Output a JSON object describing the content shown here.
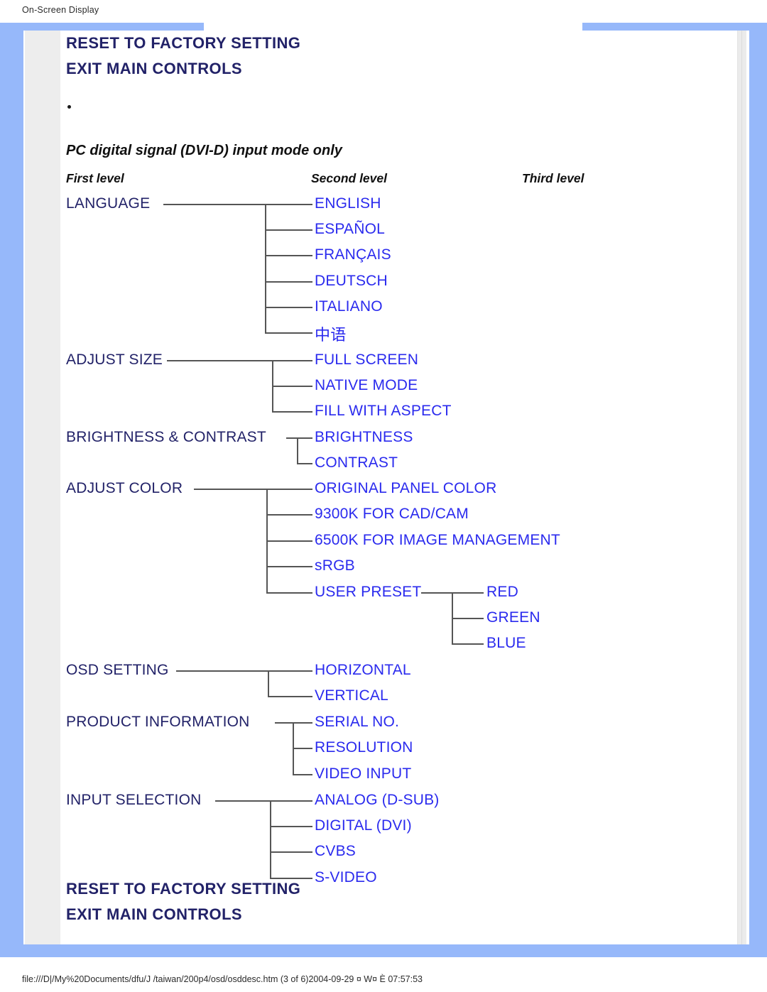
{
  "browser": {
    "title": "On-Screen Display",
    "status_url": "file:///D|/My%20Documents/dfu/J /taiwan/200p4/osd/osddesc.htm (3 of 6)2004-09-29 ¤ W¤ È 07:57:53"
  },
  "colors": {
    "page_border_blue": "#96b8fa",
    "gutter_gray": "#ededed",
    "heading_navy": "#222268",
    "menu_blue": "#2a2aee",
    "connector_gray": "#555555"
  },
  "headings": {
    "top": [
      "RESET TO FACTORY SETTING",
      "EXIT MAIN CONTROLS"
    ],
    "bottom": [
      "RESET TO FACTORY SETTING",
      "EXIT MAIN CONTROLS"
    ]
  },
  "subtitle": "PC digital signal (DVI-D) input mode only",
  "level_headers": {
    "first": "First level",
    "second": "Second level",
    "third": "Third level"
  },
  "menu_tree": [
    {
      "label": "LANGUAGE",
      "children": [
        {
          "label": "ENGLISH"
        },
        {
          "label": "ESPAÑOL"
        },
        {
          "label": "FRANÇAIS"
        },
        {
          "label": "DEUTSCH"
        },
        {
          "label": "ITALIANO"
        },
        {
          "label": "中语"
        }
      ]
    },
    {
      "label": "ADJUST SIZE",
      "children": [
        {
          "label": "FULL SCREEN"
        },
        {
          "label": "NATIVE MODE"
        },
        {
          "label": "FILL WITH ASPECT"
        }
      ]
    },
    {
      "label": "BRIGHTNESS & CONTRAST",
      "children": [
        {
          "label": "BRIGHTNESS"
        },
        {
          "label": "CONTRAST"
        }
      ]
    },
    {
      "label": "ADJUST COLOR",
      "children": [
        {
          "label": "ORIGINAL PANEL COLOR"
        },
        {
          "label": "9300K FOR CAD/CAM"
        },
        {
          "label": "6500K FOR IMAGE MANAGEMENT"
        },
        {
          "label": "sRGB"
        },
        {
          "label": "USER PRESET",
          "children": [
            {
              "label": "RED"
            },
            {
              "label": "GREEN"
            },
            {
              "label": "BLUE"
            }
          ]
        }
      ]
    },
    {
      "label": "OSD SETTING",
      "children": [
        {
          "label": "HORIZONTAL"
        },
        {
          "label": "VERTICAL"
        }
      ]
    },
    {
      "label": "PRODUCT INFORMATION",
      "children": [
        {
          "label": "SERIAL NO."
        },
        {
          "label": "RESOLUTION"
        },
        {
          "label": "VIDEO INPUT"
        }
      ]
    },
    {
      "label": "INPUT SELECTION",
      "children": [
        {
          "label": "ANALOG (D-SUB)"
        },
        {
          "label": "DIGITAL (DVI)"
        },
        {
          "label": "CVBS"
        },
        {
          "label": "S-VIDEO"
        }
      ]
    }
  ]
}
